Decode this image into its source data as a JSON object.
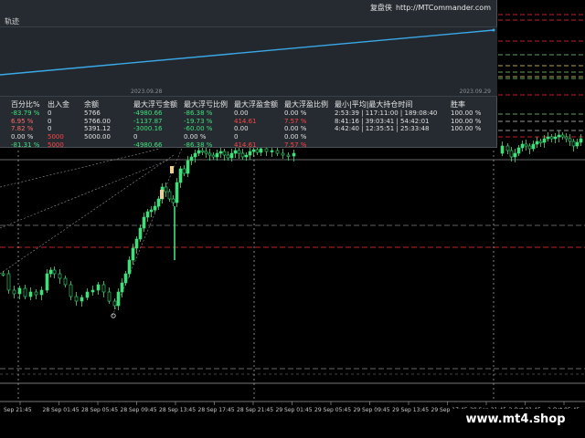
{
  "panel": {
    "brand_zh": "复盘侠",
    "brand_url": "http://MTCommander.com",
    "track_label": "轨迹",
    "mini_dates": [
      "2023.09.28",
      "2023.09.29"
    ]
  },
  "stats": {
    "headers": [
      "百分比%",
      "出入金",
      "余额",
      "最大浮亏金额",
      "最大浮亏比例",
      "最大浮盈金额",
      "最大浮盈比例",
      "最小|平均|最大持仓时间",
      "胜率"
    ],
    "rows": [
      [
        {
          "t": "-83.79 %",
          "c": "green"
        },
        {
          "t": "0",
          "c": "white"
        },
        {
          "t": "5766",
          "c": "white"
        },
        {
          "t": "-4980.66",
          "c": "green"
        },
        {
          "t": "-86.38 %",
          "c": "green"
        },
        {
          "t": "0.00",
          "c": "white"
        },
        {
          "t": "0.00 %",
          "c": "white"
        },
        {
          "t": "2:53:39 | 117:11:00 | 189:08:40",
          "c": "white"
        },
        {
          "t": "100.00 %",
          "c": "white"
        }
      ],
      [
        {
          "t": "6.95 %",
          "c": "pink"
        },
        {
          "t": "0",
          "c": "white"
        },
        {
          "t": "5766.00",
          "c": "white"
        },
        {
          "t": "-1137.87",
          "c": "green"
        },
        {
          "t": "-19.73 %",
          "c": "green"
        },
        {
          "t": "414.61",
          "c": "red"
        },
        {
          "t": "7.57 %",
          "c": "red"
        },
        {
          "t": "8:41:16 | 39:03:41 | 54:42:01",
          "c": "white"
        },
        {
          "t": "100.00 %",
          "c": "white"
        }
      ],
      [
        {
          "t": "7.82 %",
          "c": "pink"
        },
        {
          "t": "0",
          "c": "white"
        },
        {
          "t": "5391.12",
          "c": "white"
        },
        {
          "t": "-3000.16",
          "c": "green"
        },
        {
          "t": "-60.00 %",
          "c": "green"
        },
        {
          "t": "0.00",
          "c": "white"
        },
        {
          "t": "0.00 %",
          "c": "white"
        },
        {
          "t": "4:42:40 | 12:35:51 | 25:33:48",
          "c": "white"
        },
        {
          "t": "100.00 %",
          "c": "white"
        }
      ],
      [
        {
          "t": "0.00 %",
          "c": "white"
        },
        {
          "t": "5000",
          "c": "red"
        },
        {
          "t": "5000.00",
          "c": "white"
        },
        {
          "t": "0",
          "c": "white"
        },
        {
          "t": "0.00 %",
          "c": "white"
        },
        {
          "t": "0",
          "c": "white"
        },
        {
          "t": "0.00 %",
          "c": "white"
        },
        {
          "t": "",
          "c": "white"
        },
        {
          "t": "",
          "c": "white"
        }
      ],
      [
        {
          "t": "-81.31 %",
          "c": "green"
        },
        {
          "t": "5000",
          "c": "red"
        },
        {
          "t": "",
          "c": "white"
        },
        {
          "t": "-4980.66",
          "c": "green"
        },
        {
          "t": "-86.38 %",
          "c": "green"
        },
        {
          "t": "414.61",
          "c": "red"
        },
        {
          "t": "7.57 %",
          "c": "red"
        },
        {
          "t": "",
          "c": "white"
        },
        {
          "t": "",
          "c": "white"
        }
      ]
    ]
  },
  "time_axis": [
    "Sep 21:45",
    "28 Sep 01:45",
    "28 Sep 05:45",
    "28 Sep 09:45",
    "28 Sep 13:45",
    "28 Sep 17:45",
    "28 Sep 21:45",
    "29 Sep 01:45",
    "29 Sep 05:45",
    "29 Sep 09:45",
    "29 Sep 13:45",
    "29 Sep 17:45",
    "29 Sep 21:45",
    "2 Oct 01:45",
    "2 Oct 05:45"
  ],
  "watermark": "www.mt4.shop",
  "colors": {
    "bull": "#3ee07a",
    "bear": "#3ee07a",
    "level_red": "#ff3030",
    "level_green": "#7cdc7c",
    "level_yellow": "#e8e070",
    "track_line": "#3aa9e8",
    "vline": "#d8d8d8"
  }
}
